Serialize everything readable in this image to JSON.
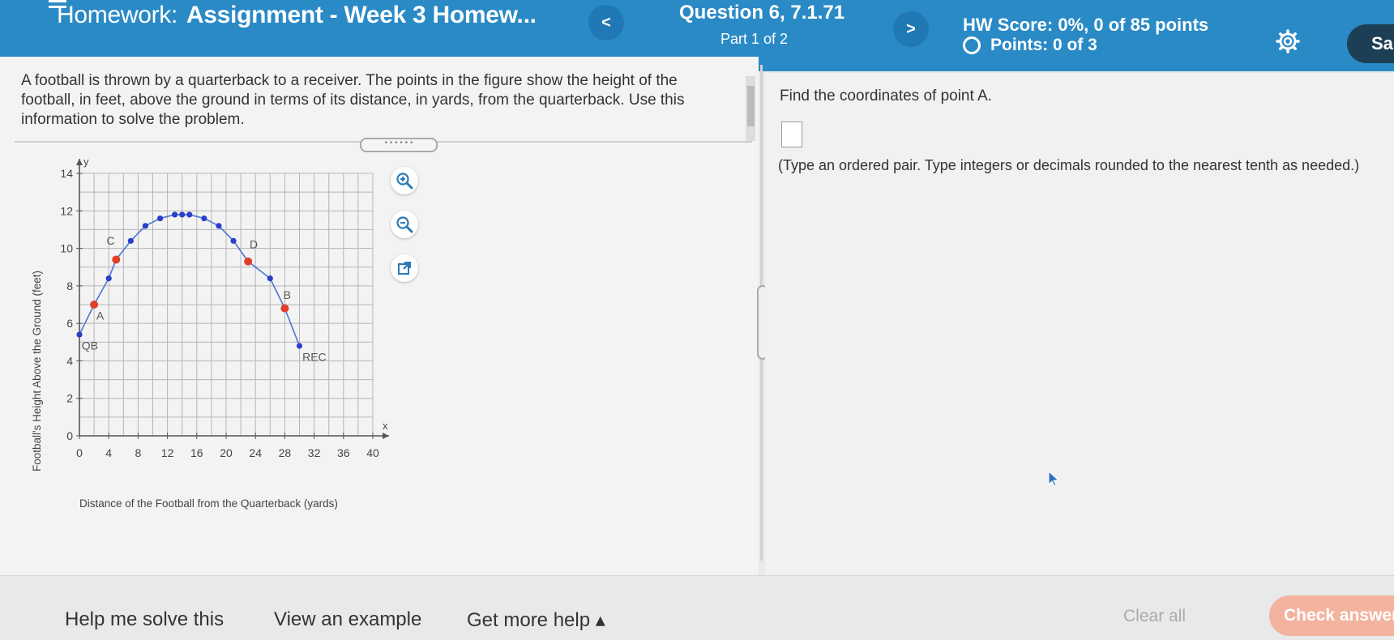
{
  "header": {
    "title_lead": "Homework:",
    "title_main": "Assignment - Week 3 Homew...",
    "prev_label": "<",
    "next_label": ">",
    "question_title": "Question 6, 7.1.71",
    "question_part": "Part 1 of 2",
    "hw_score": "HW Score: 0%, 0 of 85 points",
    "points": "Points: 0 of 3",
    "save_label": "Sa",
    "icons": [
      "menu-icon",
      "gear-icon",
      "circle-icon"
    ]
  },
  "problem": {
    "text": "A football is thrown by a quarterback to a receiver. The points in the figure show the height of the football, in feet, above the ground in terms of its distance, in yards, from the quarterback. Use this information to solve the problem."
  },
  "graph_tools": [
    "zoom-in-icon",
    "zoom-out-icon",
    "popout-icon"
  ],
  "chart_data": {
    "type": "scatter",
    "xlabel": "Distance of the Football from the Quarterback (yards)",
    "ylabel": "Football's Height Above the Ground (feet)",
    "x_axis_letter": "x",
    "y_axis_letter": "y",
    "xlim": [
      0,
      40
    ],
    "ylim": [
      0,
      14
    ],
    "x_ticks": [
      0,
      4,
      8,
      12,
      16,
      20,
      24,
      28,
      32,
      36,
      40
    ],
    "y_ticks": [
      0,
      2,
      4,
      6,
      8,
      10,
      12,
      14
    ],
    "grid": true,
    "series": [
      {
        "color": "#2a3fc9",
        "points": [
          {
            "x": 0,
            "y": 5.4
          },
          {
            "x": 4,
            "y": 8.4
          },
          {
            "x": 7,
            "y": 10.4
          },
          {
            "x": 9,
            "y": 11.2
          },
          {
            "x": 11,
            "y": 11.6
          },
          {
            "x": 13,
            "y": 11.8
          },
          {
            "x": 14,
            "y": 11.8
          },
          {
            "x": 15,
            "y": 11.8
          },
          {
            "x": 17,
            "y": 11.6
          },
          {
            "x": 19,
            "y": 11.2
          },
          {
            "x": 21,
            "y": 10.4
          },
          {
            "x": 26,
            "y": 8.4
          },
          {
            "x": 30,
            "y": 4.8
          }
        ]
      },
      {
        "color": "#e0402a",
        "points": [
          {
            "x": 2,
            "y": 7.0
          },
          {
            "x": 5,
            "y": 9.4
          },
          {
            "x": 23,
            "y": 9.3
          },
          {
            "x": 28,
            "y": 6.8
          }
        ]
      }
    ],
    "annotations": [
      {
        "text": "QB",
        "x": 0.3,
        "y": 4.6
      },
      {
        "text": "A",
        "x": 2.3,
        "y": 6.2
      },
      {
        "text": "C",
        "x": 3.7,
        "y": 10.2
      },
      {
        "text": "D",
        "x": 23.2,
        "y": 10.0
      },
      {
        "text": "B",
        "x": 27.8,
        "y": 7.3
      },
      {
        "text": "REC",
        "x": 30.4,
        "y": 4.0
      }
    ]
  },
  "answer": {
    "prompt": "Find the coordinates of point A.",
    "input_value": "",
    "hint": "(Type an ordered pair. Type integers or decimals rounded to the nearest tenth as needed.)"
  },
  "footer": {
    "help": "Help me solve this",
    "example": "View an example",
    "more_help": "Get more help ▴",
    "clear_all": "Clear all",
    "check": "Check answer"
  }
}
